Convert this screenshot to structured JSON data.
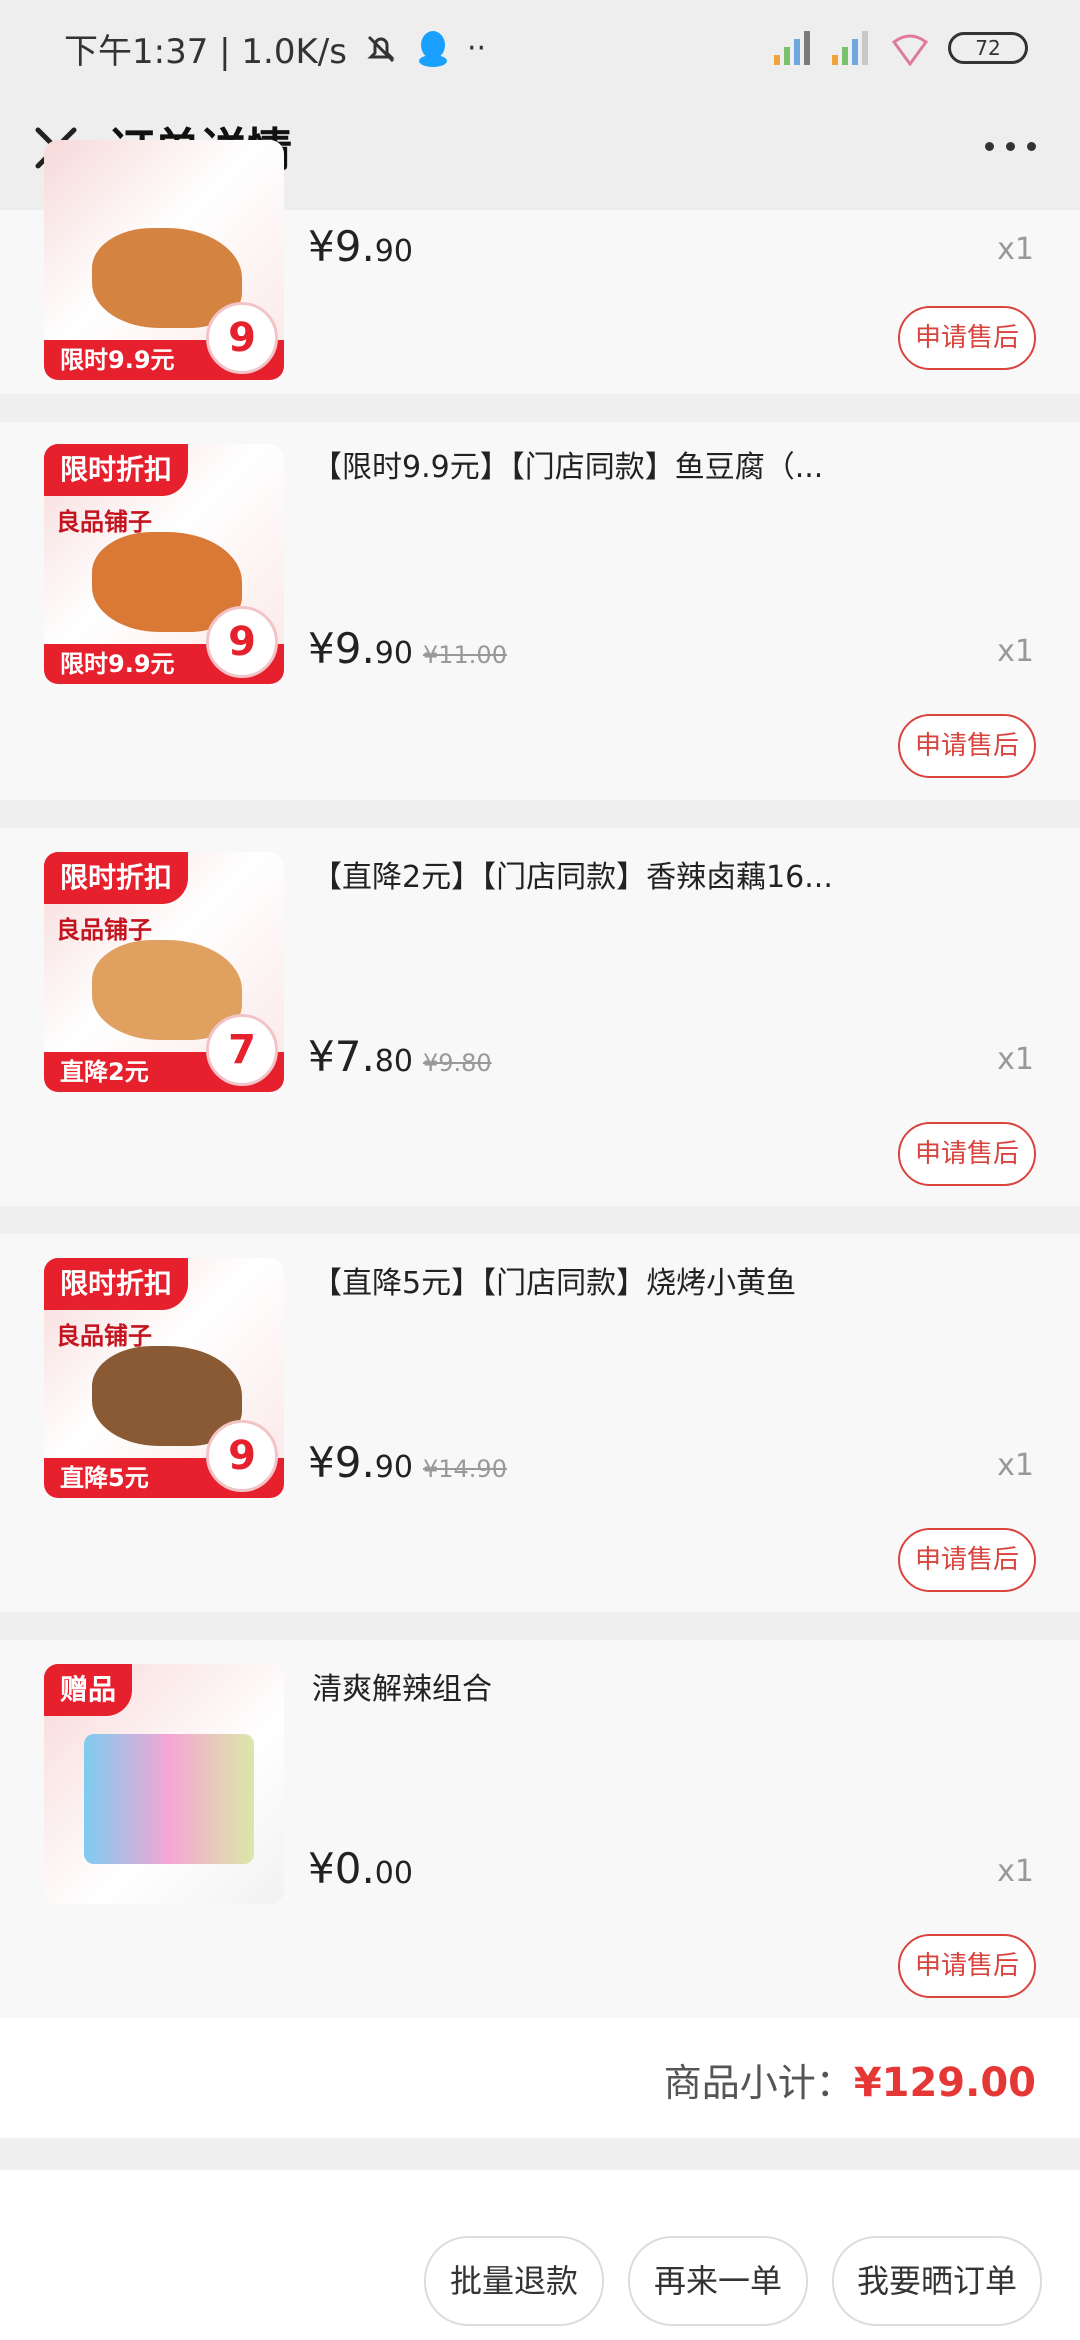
{
  "status": {
    "left_text": "下午1:37 | 1.0K/s",
    "battery": "72"
  },
  "header": {
    "title": "订单详情"
  },
  "items": [
    {
      "tag": "",
      "brand": "",
      "banner": "限时9.9元",
      "badge": "9",
      "name": "",
      "price_int": "¥9.",
      "price_dec": "90",
      "orig": "",
      "qty": "x1",
      "aftersale": "申请售后"
    },
    {
      "tag": "限时折扣",
      "brand": "良品铺子",
      "banner": "限时9.9元",
      "badge": "9",
      "name": "【限时9.9元】【门店同款】鱼豆腐（...",
      "price_int": "¥9.",
      "price_dec": "90",
      "orig": "¥11.00",
      "qty": "x1",
      "aftersale": "申请售后"
    },
    {
      "tag": "限时折扣",
      "brand": "良品铺子",
      "banner": "直降2元",
      "badge": "7",
      "name": "【直降2元】【门店同款】香辣卤藕16...",
      "price_int": "¥7.",
      "price_dec": "80",
      "orig": "¥9.80",
      "qty": "x1",
      "aftersale": "申请售后"
    },
    {
      "tag": "限时折扣",
      "brand": "良品铺子",
      "banner": "直降5元",
      "badge": "9",
      "name": "【直降5元】【门店同款】烧烤小黄鱼",
      "price_int": "¥9.",
      "price_dec": "90",
      "orig": "¥14.90",
      "qty": "x1",
      "aftersale": "申请售后"
    },
    {
      "tag": "赠品",
      "brand": "",
      "banner": "",
      "badge": "",
      "name": "清爽解辣组合",
      "price_int": "¥0.",
      "price_dec": "00",
      "orig": "",
      "qty": "x1",
      "aftersale": "申请售后"
    }
  ],
  "subtotal": {
    "label": "商品小计：",
    "amount": "¥129.00"
  },
  "footer": {
    "refund_label": "批量退款",
    "reorder_label": "再来一单",
    "review_label": "我要晒订单"
  }
}
